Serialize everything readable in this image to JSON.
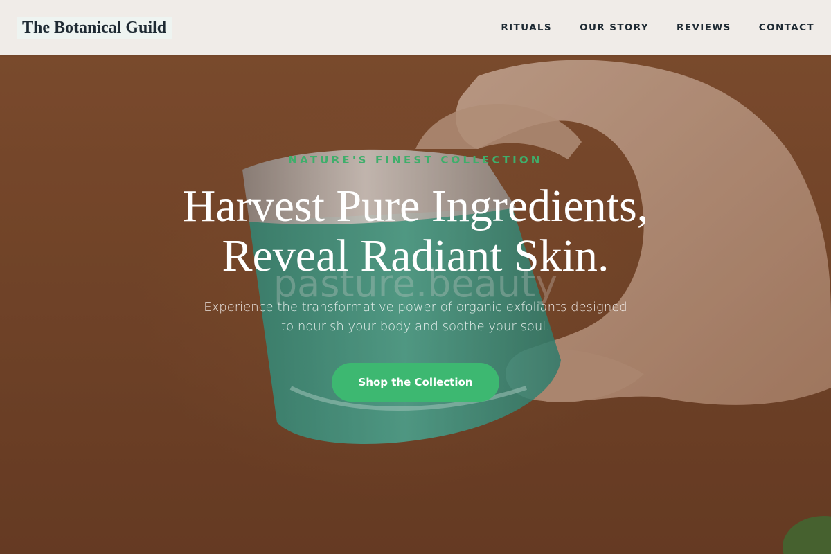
{
  "header": {
    "logo": "The Botanical Guild",
    "nav": [
      {
        "label": "RITUALS"
      },
      {
        "label": "OUR STORY"
      },
      {
        "label": "REVIEWS"
      },
      {
        "label": "CONTACT"
      }
    ]
  },
  "hero": {
    "eyebrow": "NATURE'S FINEST COLLECTION",
    "headline_line1": "Harvest Pure Ingredients,",
    "headline_line2": "Reveal Radiant Skin.",
    "subtext_line1": "Experience the transformative power of organic exfoliants designed",
    "subtext_line2": "to nourish your body and soothe your soul.",
    "cta_label": "Shop the Collection",
    "image_brand_text": "pasture.beauty"
  },
  "colors": {
    "accent": "#3db871",
    "eyebrow": "#3fae6b",
    "header_bg": "#f5f3f0",
    "logo_text": "#1e2a33",
    "hero_bg": "#7d4c2d"
  }
}
